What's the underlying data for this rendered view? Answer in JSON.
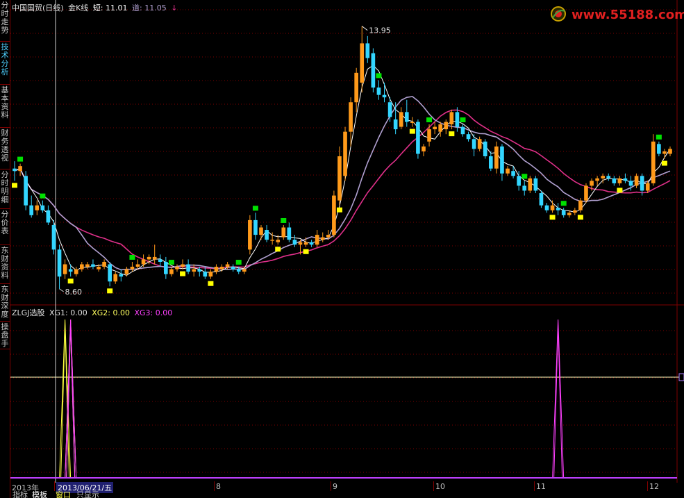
{
  "sidebar": {
    "items": [
      {
        "label": "分时走势",
        "active": false
      },
      {
        "label": "技术分析",
        "active": true
      },
      {
        "label": "基本资料",
        "active": false
      },
      {
        "label": "财务透视",
        "active": false
      },
      {
        "label": "分时明细",
        "active": false
      },
      {
        "label": "分价表",
        "active": false
      },
      {
        "label": "东财资料",
        "active": false
      },
      {
        "label": "东财深度",
        "active": false
      },
      {
        "label": "操盘手",
        "active": false
      }
    ]
  },
  "header": {
    "title": "中国国贸(日线)",
    "indicator": "金K线",
    "short_label": "短:",
    "short_value": "11.01",
    "dao_label": "道:",
    "dao_value": "11.05",
    "arrow": "↓"
  },
  "sub_header": {
    "name": "ZLGJ选股",
    "xg1": "XG1: 0.00",
    "xg2": "XG2: 0.00",
    "xg3": "XG3: 0.00"
  },
  "annotations": {
    "high": "13.95",
    "low": "8.60"
  },
  "watermark": {
    "text": "www.55188.com"
  },
  "date_axis": {
    "labels": [
      "2013年",
      "2013/06/21/五",
      "8",
      "9",
      "10",
      "11",
      "12"
    ]
  },
  "bottom_tabs": {
    "items": [
      "指标",
      "模板",
      "窗口",
      "只显示"
    ]
  },
  "colors": {
    "up": "#ff9a1a",
    "down": "#33d6ff",
    "short_line": "#ffffff",
    "mid_line": "#b0a0d0",
    "long_line": "#e0308a",
    "buy_marker": "#ffff00",
    "sell_marker": "#00e000",
    "grid": "#800000",
    "xg1": "#ffff40",
    "xg2": "#ffff80",
    "xg3": "#ff40ff"
  },
  "chart_data": {
    "type": "candlestick",
    "title": "中国国贸(日线)",
    "ylim": [
      8.4,
      14.2
    ],
    "marks": {
      "high": 13.95,
      "low": 8.6
    },
    "candles": [
      [
        11.05,
        11.2,
        10.8,
        11.0
      ],
      [
        11.0,
        11.15,
        10.9,
        11.1
      ],
      [
        10.9,
        11.0,
        10.2,
        10.3
      ],
      [
        10.3,
        10.5,
        10.05,
        10.1
      ],
      [
        10.2,
        10.4,
        10.1,
        10.3
      ],
      [
        10.3,
        10.4,
        10.15,
        10.2
      ],
      [
        10.2,
        10.3,
        9.9,
        9.95
      ],
      [
        9.9,
        10.0,
        9.3,
        9.4
      ],
      [
        9.4,
        9.5,
        8.6,
        8.85
      ],
      [
        8.9,
        9.2,
        8.8,
        9.1
      ],
      [
        9.0,
        9.1,
        8.85,
        8.95
      ],
      [
        8.9,
        9.05,
        8.85,
        9.0
      ],
      [
        9.0,
        9.15,
        8.95,
        9.1
      ],
      [
        9.05,
        9.15,
        9.0,
        9.1
      ],
      [
        9.1,
        9.2,
        9.0,
        9.05
      ],
      [
        9.0,
        9.1,
        8.95,
        9.05
      ],
      [
        9.05,
        9.2,
        9.0,
        9.15
      ],
      [
        9.1,
        9.15,
        8.65,
        8.75
      ],
      [
        8.75,
        8.95,
        8.7,
        8.9
      ],
      [
        8.9,
        9.0,
        8.75,
        8.85
      ],
      [
        8.9,
        9.05,
        8.85,
        9.0
      ],
      [
        9.0,
        9.15,
        8.95,
        9.05
      ],
      [
        9.05,
        9.2,
        9.0,
        9.1
      ],
      [
        9.1,
        9.3,
        9.05,
        9.2
      ],
      [
        9.2,
        9.3,
        9.1,
        9.25
      ],
      [
        9.2,
        9.5,
        9.1,
        9.25
      ],
      [
        9.2,
        9.3,
        9.05,
        9.15
      ],
      [
        9.15,
        9.25,
        8.8,
        8.9
      ],
      [
        8.9,
        9.05,
        8.85,
        9.0
      ],
      [
        9.0,
        9.1,
        8.95,
        9.05
      ],
      [
        9.05,
        9.2,
        9.0,
        9.1
      ],
      [
        9.1,
        9.2,
        8.9,
        8.95
      ],
      [
        8.95,
        9.1,
        8.85,
        9.0
      ],
      [
        9.0,
        9.05,
        8.85,
        8.95
      ],
      [
        8.95,
        9.05,
        8.8,
        8.85
      ],
      [
        8.85,
        9.0,
        8.8,
        8.95
      ],
      [
        8.95,
        9.1,
        8.9,
        9.05
      ],
      [
        9.0,
        9.1,
        8.95,
        9.05
      ],
      [
        9.05,
        9.15,
        9.0,
        9.1
      ],
      [
        9.05,
        9.1,
        8.95,
        9.0
      ],
      [
        9.0,
        9.05,
        8.9,
        8.95
      ],
      [
        8.95,
        9.05,
        8.9,
        9.0
      ],
      [
        9.4,
        10.1,
        9.3,
        10.0
      ],
      [
        10.0,
        10.15,
        9.6,
        9.7
      ],
      [
        9.7,
        9.9,
        9.6,
        9.85
      ],
      [
        9.8,
        9.9,
        9.55,
        9.6
      ],
      [
        9.6,
        9.75,
        9.5,
        9.6
      ],
      [
        9.55,
        9.7,
        9.5,
        9.6
      ],
      [
        9.65,
        9.9,
        9.6,
        9.85
      ],
      [
        9.85,
        9.95,
        9.55,
        9.6
      ],
      [
        9.6,
        9.7,
        9.45,
        9.5
      ],
      [
        9.5,
        9.6,
        9.3,
        9.55
      ],
      [
        9.5,
        9.65,
        9.45,
        9.55
      ],
      [
        9.55,
        9.6,
        9.45,
        9.5
      ],
      [
        9.5,
        9.8,
        9.45,
        9.7
      ],
      [
        9.6,
        9.75,
        9.55,
        9.65
      ],
      [
        9.65,
        9.8,
        9.6,
        9.7
      ],
      [
        9.7,
        10.6,
        9.65,
        10.5
      ],
      [
        10.4,
        11.5,
        10.3,
        11.3
      ],
      [
        10.9,
        11.9,
        10.8,
        11.8
      ],
      [
        11.8,
        12.5,
        11.5,
        12.4
      ],
      [
        12.4,
        13.1,
        12.2,
        13.0
      ],
      [
        12.8,
        13.95,
        12.6,
        13.6
      ],
      [
        13.6,
        13.75,
        13.2,
        13.3
      ],
      [
        13.4,
        13.5,
        12.6,
        12.7
      ],
      [
        12.7,
        12.85,
        12.45,
        12.55
      ],
      [
        12.55,
        12.8,
        12.4,
        12.5
      ],
      [
        12.4,
        12.5,
        12.0,
        12.1
      ],
      [
        12.05,
        12.4,
        11.75,
        11.85
      ],
      [
        11.9,
        12.3,
        11.85,
        12.2
      ],
      [
        12.2,
        12.45,
        11.9,
        12.0
      ],
      [
        12.0,
        12.1,
        11.9,
        12.0
      ],
      [
        12.0,
        12.05,
        11.25,
        11.35
      ],
      [
        11.4,
        11.55,
        11.3,
        11.5
      ],
      [
        11.6,
        11.95,
        11.5,
        11.85
      ],
      [
        11.85,
        12.0,
        11.75,
        11.9
      ],
      [
        11.8,
        12.0,
        11.7,
        11.95
      ],
      [
        11.85,
        12.05,
        11.75,
        12.0
      ],
      [
        11.95,
        12.25,
        11.85,
        12.2
      ],
      [
        12.2,
        12.3,
        11.8,
        11.9
      ],
      [
        11.9,
        11.95,
        11.7,
        11.75
      ],
      [
        11.75,
        11.8,
        11.6,
        11.65
      ],
      [
        11.65,
        11.75,
        11.3,
        11.45
      ],
      [
        11.45,
        11.7,
        11.4,
        11.65
      ],
      [
        11.6,
        11.65,
        11.25,
        11.3
      ],
      [
        11.3,
        11.4,
        11.0,
        11.05
      ],
      [
        11.05,
        11.6,
        10.95,
        11.5
      ],
      [
        11.5,
        11.55,
        10.8,
        10.95
      ],
      [
        10.95,
        11.1,
        10.9,
        11.05
      ],
      [
        11.0,
        11.1,
        10.85,
        10.9
      ],
      [
        10.9,
        11.0,
        10.6,
        10.7
      ],
      [
        10.7,
        10.8,
        10.5,
        10.6
      ],
      [
        10.6,
        10.9,
        10.55,
        10.85
      ],
      [
        10.85,
        10.9,
        10.55,
        10.6
      ],
      [
        10.55,
        10.6,
        10.25,
        10.3
      ],
      [
        10.3,
        10.35,
        10.15,
        10.2
      ],
      [
        10.2,
        10.4,
        10.15,
        10.3
      ],
      [
        10.25,
        10.35,
        10.1,
        10.2
      ],
      [
        10.2,
        10.25,
        10.05,
        10.1
      ],
      [
        10.1,
        10.2,
        10.05,
        10.15
      ],
      [
        10.15,
        10.25,
        10.1,
        10.2
      ],
      [
        10.2,
        10.45,
        10.15,
        10.4
      ],
      [
        10.4,
        10.75,
        10.35,
        10.7
      ],
      [
        10.7,
        10.85,
        10.6,
        10.8
      ],
      [
        10.8,
        10.9,
        10.7,
        10.85
      ],
      [
        10.85,
        10.95,
        10.75,
        10.9
      ],
      [
        10.9,
        10.95,
        10.8,
        10.85
      ],
      [
        10.85,
        10.9,
        10.7,
        10.75
      ],
      [
        10.75,
        10.9,
        10.7,
        10.85
      ],
      [
        10.85,
        10.95,
        10.75,
        10.8
      ],
      [
        10.8,
        10.9,
        10.6,
        10.7
      ],
      [
        10.7,
        10.95,
        10.65,
        10.9
      ],
      [
        10.9,
        10.95,
        10.5,
        10.6
      ],
      [
        10.6,
        10.8,
        10.55,
        10.75
      ],
      [
        10.75,
        11.75,
        10.7,
        11.6
      ],
      [
        11.55,
        11.6,
        11.3,
        11.35
      ],
      [
        11.35,
        11.45,
        11.25,
        11.4
      ],
      [
        11.35,
        11.5,
        11.3,
        11.45
      ]
    ],
    "buy_marker_indices": [
      0,
      10,
      17,
      30,
      35,
      47,
      52,
      58,
      71,
      78,
      96,
      101,
      108,
      116
    ],
    "sell_marker_indices": [
      1,
      5,
      21,
      28,
      40,
      43,
      48,
      65,
      74,
      80,
      91,
      98,
      115
    ],
    "sub_chart": {
      "name": "ZLGJ选股",
      "ylim": [
        0,
        1
      ],
      "series": [
        {
          "name": "XG1",
          "spikes": [
            9
          ]
        },
        {
          "name": "XG2",
          "spikes": [
            10
          ]
        },
        {
          "name": "XG3",
          "spikes": [
            10,
            97
          ]
        }
      ]
    }
  }
}
